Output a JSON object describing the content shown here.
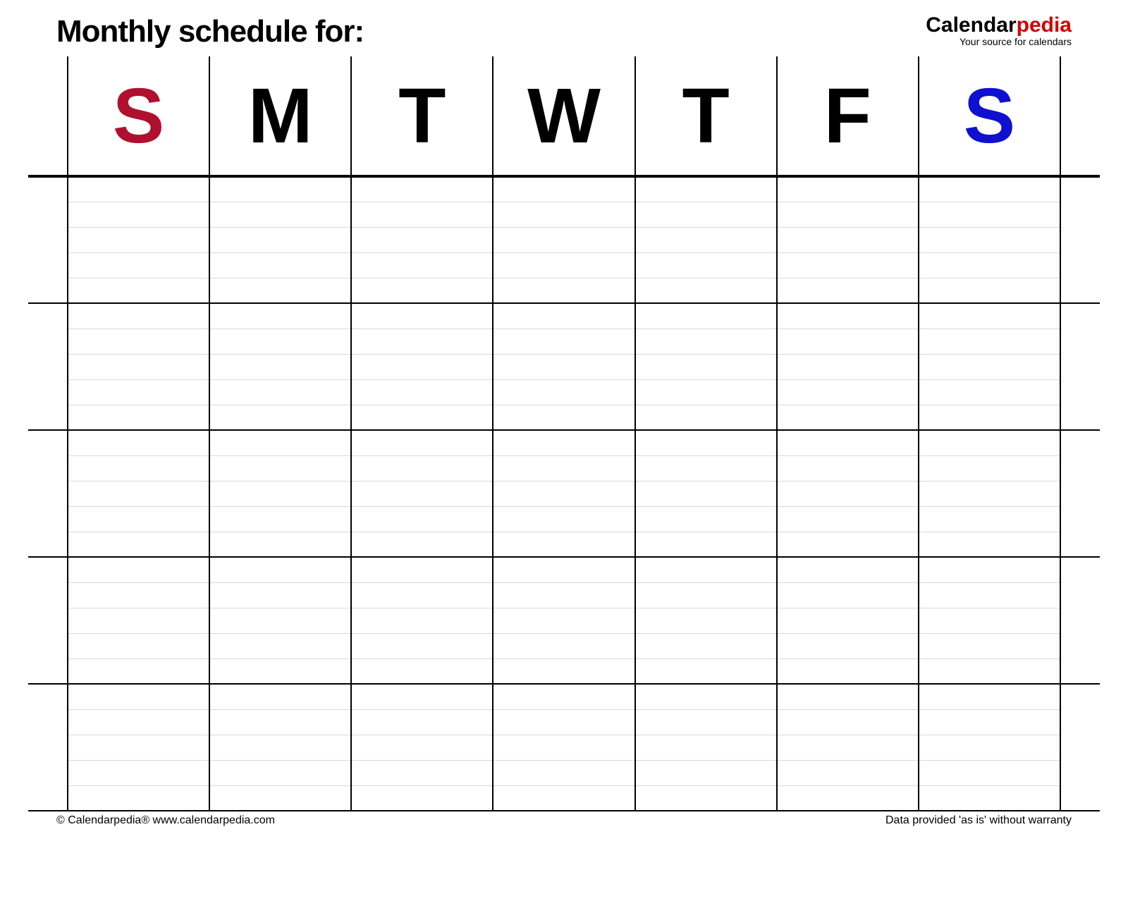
{
  "header": {
    "title": "Monthly schedule for:"
  },
  "logo": {
    "part1": "Calendar",
    "part2": "pedia",
    "tagline": "Your source for calendars"
  },
  "days": [
    {
      "letter": "S",
      "color": "red"
    },
    {
      "letter": "M",
      "color": "black"
    },
    {
      "letter": "T",
      "color": "black"
    },
    {
      "letter": "W",
      "color": "black"
    },
    {
      "letter": "T",
      "color": "black"
    },
    {
      "letter": "F",
      "color": "black"
    },
    {
      "letter": "S",
      "color": "blue"
    }
  ],
  "grid": {
    "weeks": 5,
    "lines_per_week": 5
  },
  "footer": {
    "left": "© Calendarpedia®   www.calendarpedia.com",
    "right": "Data provided 'as is' without warranty"
  }
}
